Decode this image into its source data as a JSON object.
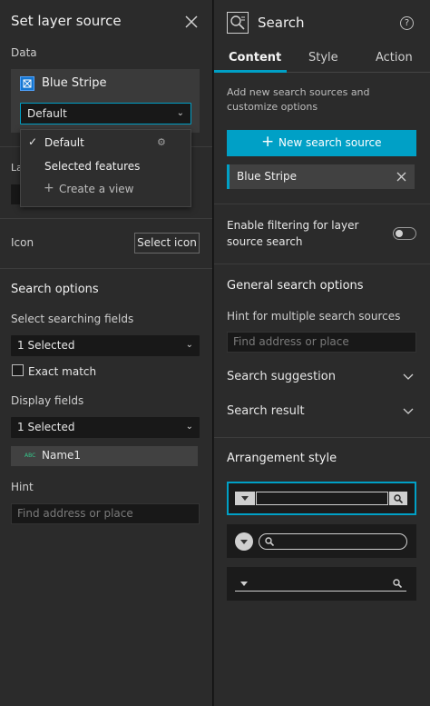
{
  "left_panel": {
    "title": "Set layer source",
    "data_label": "Data",
    "source_name": "Blue Stripe",
    "view_select_value": "Default",
    "dropdown_options": [
      "Default",
      "Selected features"
    ],
    "create_view_label": "Create a view",
    "icon_label": "Icon",
    "select_icon_label": "Select icon",
    "search_options_title": "Search options",
    "searching_fields_label": "Select searching fields",
    "searching_fields_value": "1 Selected",
    "exact_match_label": "Exact match",
    "display_fields_label": "Display fields",
    "display_fields_value": "1 Selected",
    "field_type": "ABC",
    "field_name": "Name1",
    "hint_label": "Hint",
    "hint_placeholder": "Find address or place"
  },
  "right_panel": {
    "title": "Search",
    "help": "?",
    "tabs": [
      "Content",
      "Style",
      "Action"
    ],
    "description": "Add new search sources and customize options",
    "new_source_button": "New search source",
    "source_item": "Blue Stripe",
    "filtering_label": "Enable filtering for layer source search",
    "general_options_title": "General search options",
    "hint_multiple_label": "Hint for multiple search sources",
    "hint_multiple_placeholder": "Find address or place",
    "suggestion_label": "Search suggestion",
    "result_label": "Search result",
    "arrangement_title": "Arrangement style"
  },
  "colors": {
    "accent": "#00a0c6",
    "panel_bg": "#2b2b2b",
    "input_bg": "#181818",
    "selected_item_bg": "#414141"
  },
  "icons": [
    "close-icon",
    "layer-icon",
    "search-widget-icon",
    "help-icon",
    "check-icon",
    "gear-icon",
    "plus-icon",
    "chevron-down-icon",
    "toggle-switch",
    "search-icon"
  ]
}
